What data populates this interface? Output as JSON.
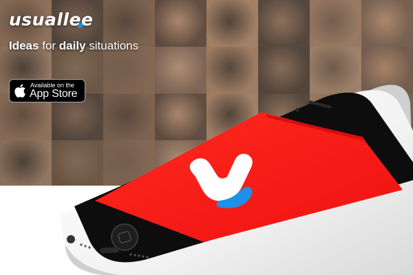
{
  "brand": {
    "logo_text": "usuallee",
    "tagline_prefix": "Ideas",
    "tagline_for": "for",
    "tagline_emphasis": "daily",
    "tagline_suffix": "situations",
    "dot_color": "#1e90e8"
  },
  "appstore": {
    "small_text": "Available on the",
    "big_text": "App Store",
    "icon": "apple-icon"
  },
  "phone": {
    "screen_color": "#ff1a1a",
    "app_logo_color": "#ffffff",
    "app_dot_color": "#1e90e8",
    "body_color": "#f5f5f5",
    "status": {
      "carrier": "",
      "time": "",
      "battery": ""
    }
  },
  "colors": {
    "hero_bg": "#3a342f",
    "page_bg": "#ffffff"
  }
}
